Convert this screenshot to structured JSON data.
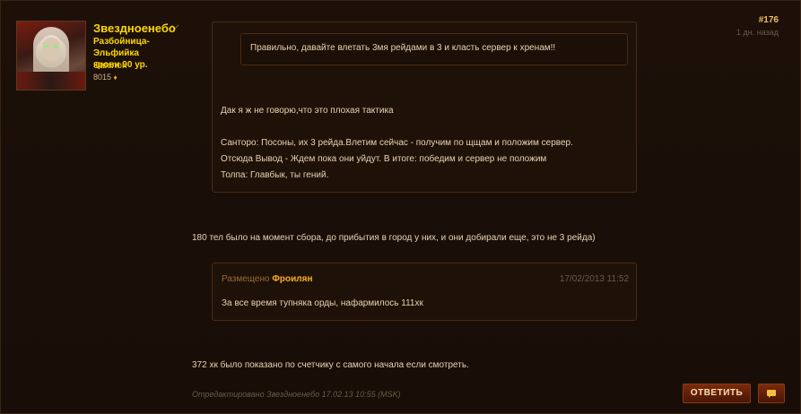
{
  "author": {
    "name": "Звездноенебо",
    "class_line1": "Разбойница-Эльфийка",
    "class_line2": "крови 90 ур.",
    "guild": "Эшелон",
    "points": "8015"
  },
  "post": {
    "number": "#176",
    "time": "1 дн. назад"
  },
  "quote_outer": {
    "nested_quote": "Правильно, давайте влетать 3мя рейдами в 3 и класть сервер к хренам!!",
    "lines": [
      "Дак я ж не говорю,что это плохая тактика",
      "Санторо: Посоны, их 3 рейда.Влетим сейчас - получим по щщам и положим сервер.",
      "Отсюда Вывод - Ждем пока они уйдут. В итоге: победим и сервер не положим",
      "Толпа: Главбык, ты гений."
    ]
  },
  "body": {
    "line1": "180 тел было на момент сбора, до прибытия в город у них, и они добирали еще, это не 3 рейда)",
    "line2": "372 хк было показано по счетчику с самого начала если смотреть."
  },
  "quote2": {
    "posted_label": "Размещено",
    "author": "Фроилян",
    "date": "17/02/2013 11:52",
    "text": "За все время тупняка орды, нафармилось 111хк"
  },
  "edited_note": "Отредактировано Звездноенебо 17.02.13 10:55 (MSK)",
  "buttons": {
    "reply": "ОТВЕТИТЬ"
  },
  "colors": {
    "name": "#ffd700",
    "accent": "#ffb020",
    "background": "#1a0f08"
  }
}
